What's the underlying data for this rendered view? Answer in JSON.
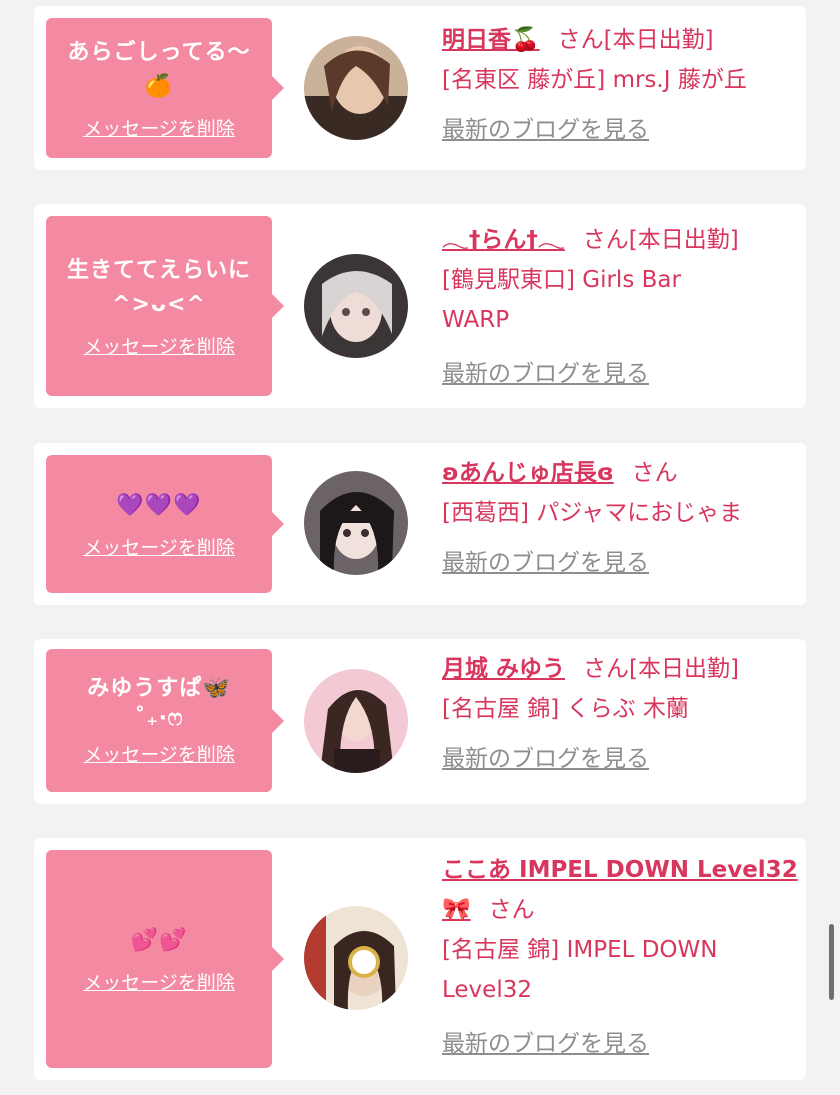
{
  "colors": {
    "bubble": "#f48aa1",
    "accent": "#d9365d",
    "link_gray": "#8e8e8e",
    "background": "#f3f2f3"
  },
  "delete_label": "メッセージを削除",
  "blog_label": "最新のブログを見る",
  "san_label": "さん",
  "items": [
    {
      "message": "あらごしってる〜\n🍊",
      "name": "明日香🍒",
      "status": "[本日出勤]",
      "location": "[名東区 藤が丘] mrs.J 藤が丘"
    },
    {
      "message": "生きててえらいに\n^>ᴗ<^",
      "name": "𓂃†らん†𓂃",
      "status": "[本日出勤]",
      "location": "[鶴見駅東口] Girls Bar\nWARP"
    },
    {
      "message": "💜💜💜",
      "name": "ʚあんじゅ店長ɞ",
      "status": "",
      "location": "[西葛西] パジャマにおじゃま"
    },
    {
      "message": "みゆうすぱ🦋\n˚₊‧ෆ",
      "name": "月城 みゆう",
      "status": "[本日出勤]",
      "location": "[名古屋 錦] くらぶ 木蘭"
    },
    {
      "message": "💕💕",
      "name": "ここあ IMPEL DOWN Level32🎀",
      "status": "",
      "location": "[名古屋 錦] IMPEL DOWN\nLevel32"
    }
  ]
}
